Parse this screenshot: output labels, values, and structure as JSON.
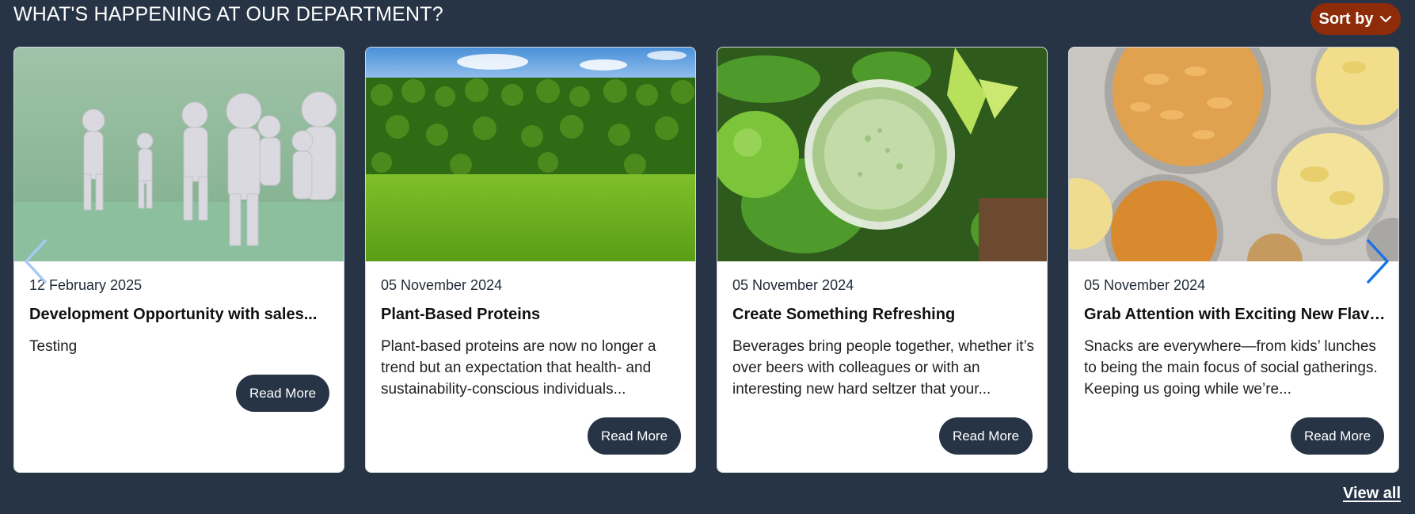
{
  "header": {
    "title": "WHAT'S HAPPENING AT OUR DEPARTMENT?",
    "sort_label": "Sort by"
  },
  "cards": [
    {
      "date": "12 February 2025",
      "title": "Development Opportunity with sales...",
      "text": "Testing",
      "button": "Read More",
      "image": "people-figures-image"
    },
    {
      "date": "05 November 2024",
      "title": "Plant-Based Proteins",
      "text": "Plant-based proteins are now no longer a trend but an expectation that health- and sustainability-conscious individuals...",
      "button": "Read More",
      "image": "hedge-lawn-image"
    },
    {
      "date": "05 November 2024",
      "title": "Create Something Refreshing",
      "text": "Beverages bring people together, whether it’s over beers with colleagues or with an interesting new hard seltzer that your...",
      "button": "Read More",
      "image": "green-juice-image"
    },
    {
      "date": "05 November 2024",
      "title": "Grab Attention with Exciting New Flavors",
      "text": "Snacks are everywhere—from kids’ lunches to being the main focus of social gatherings. Keeping us going while we’re...",
      "button": "Read More",
      "image": "snacks-bowls-image"
    }
  ],
  "footer": {
    "view_all": "View all"
  },
  "icons": {
    "sort": "chevron-down-icon",
    "prev": "chevron-left-icon",
    "next": "chevron-right-icon"
  },
  "colors": {
    "background": "#263445",
    "accent": "#8e2c09",
    "button": "#263445",
    "arrow_active": "#1a73e8",
    "arrow_inactive": "#a9c8f5"
  }
}
